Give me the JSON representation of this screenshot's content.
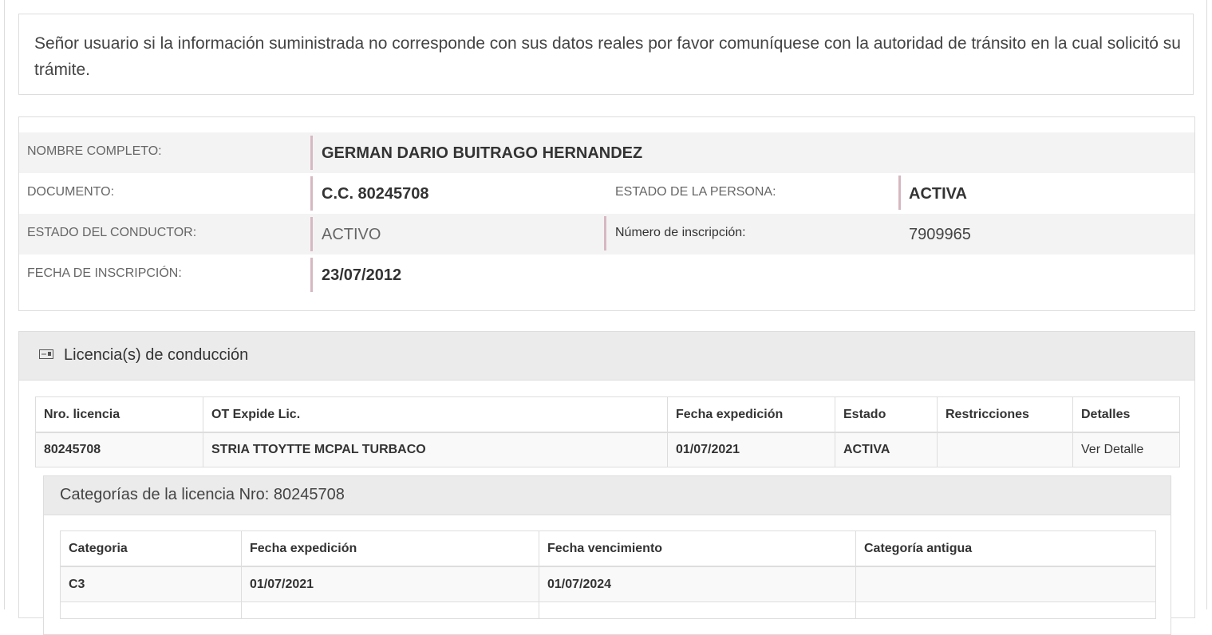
{
  "notice": {
    "text": "Señor usuario si la información suministrada no corresponde con sus datos reales por favor comuníquese con la autoridad de tránsito en la cual solicitó su trámite."
  },
  "person": {
    "nombre_label": "NOMBRE COMPLETO:",
    "nombre_value": "GERMAN DARIO BUITRAGO HERNANDEZ",
    "documento_label": "DOCUMENTO:",
    "documento_value": "C.C. 80245708",
    "estado_persona_label": "ESTADO DE LA PERSONA:",
    "estado_persona_value": "ACTIVA",
    "estado_conductor_label": "ESTADO DEL CONDUCTOR:",
    "estado_conductor_value": "ACTIVO",
    "inscripcion_label": "Número de inscripción:",
    "inscripcion_value": "7909965",
    "fecha_label": "FECHA DE INSCRIPCIÓN:",
    "fecha_value": "23/07/2012"
  },
  "licenses": {
    "title": "Licencia(s) de conducción",
    "icon": "id-card-icon",
    "headers": [
      "Nro. licencia",
      "OT Expide Lic.",
      "Fecha expedición",
      "Estado",
      "Restricciones",
      "Detalles"
    ],
    "rows": [
      {
        "numero": "80245708",
        "ot": "STRIA TTOYTTE MCPAL TURBACO",
        "fecha": "01/07/2021",
        "estado": "ACTIVA",
        "restricciones": "",
        "detalles": "Ver Detalle"
      }
    ]
  },
  "categories": {
    "title": "Categorías de la licencia Nro: 80245708",
    "headers": [
      "Categoria",
      "Fecha expedición",
      "Fecha vencimiento",
      "Categoría antigua"
    ],
    "rows": [
      {
        "categoria": "C3",
        "expedicion": "01/07/2021",
        "vencimiento": "01/07/2024",
        "antigua": ""
      }
    ]
  },
  "colors": {
    "accent_bar": "#d6b8c1",
    "row_shade": "#f4f3f3",
    "panel_header": "#ebebeb",
    "border": "#dddddd"
  }
}
